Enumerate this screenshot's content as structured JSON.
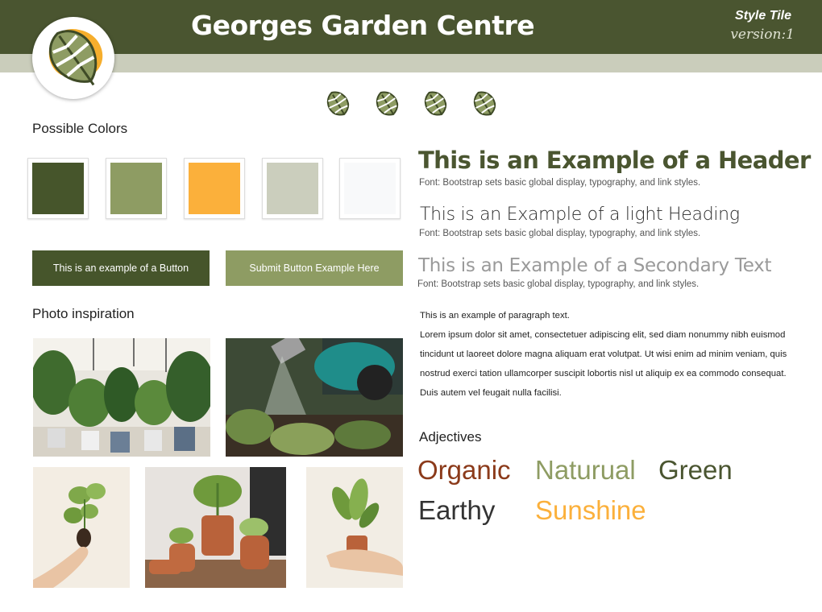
{
  "header": {
    "title": "Georges Garden Centre",
    "tile_label": "Style Tile",
    "tile_version": "version:1"
  },
  "colors_section": {
    "label": "Possible Colors",
    "swatches": [
      "#46552b",
      "#8e9c63",
      "#fbb03b",
      "#cbcebd",
      "#f8f9fa"
    ]
  },
  "buttons": {
    "primary_label": "This is an example of a Button",
    "secondary_label": "Submit Button Example Here"
  },
  "photos_section": {
    "label": "Photo inspiration"
  },
  "typography": {
    "header": "This is an Example of a Header",
    "light_heading": "This is an Example of a light Heading",
    "secondary_text": "This is an Example of a Secondary Text",
    "font_note": "Font: Bootstrap sets basic global display, typography, and link styles.",
    "paragraph_intro": "This is an example of paragraph text.",
    "paragraph_body": "Lorem ipsum dolor sit amet, consectetuer adipiscing elit, sed diam nonummy nibh euismod tincidunt ut laoreet dolore magna aliquam erat volutpat. Ut wisi enim ad minim veniam, quis nostrud exerci tation ullamcorper suscipit lobortis nisl ut aliquip ex ea commodo consequat. Duis autem vel feugait nulla facilisi."
  },
  "adjectives": {
    "label": "Adjectives",
    "words": [
      "Organic",
      "Naturual",
      "Green",
      "Earthy",
      "Sunshine"
    ],
    "colors": [
      "#8b3a1a",
      "#8e9c63",
      "#4a5530",
      "#333333",
      "#fbb03b"
    ]
  },
  "icons": {
    "logo": "monstera-leaf-logo-icon",
    "leaf": "monstera-leaf-icon"
  }
}
